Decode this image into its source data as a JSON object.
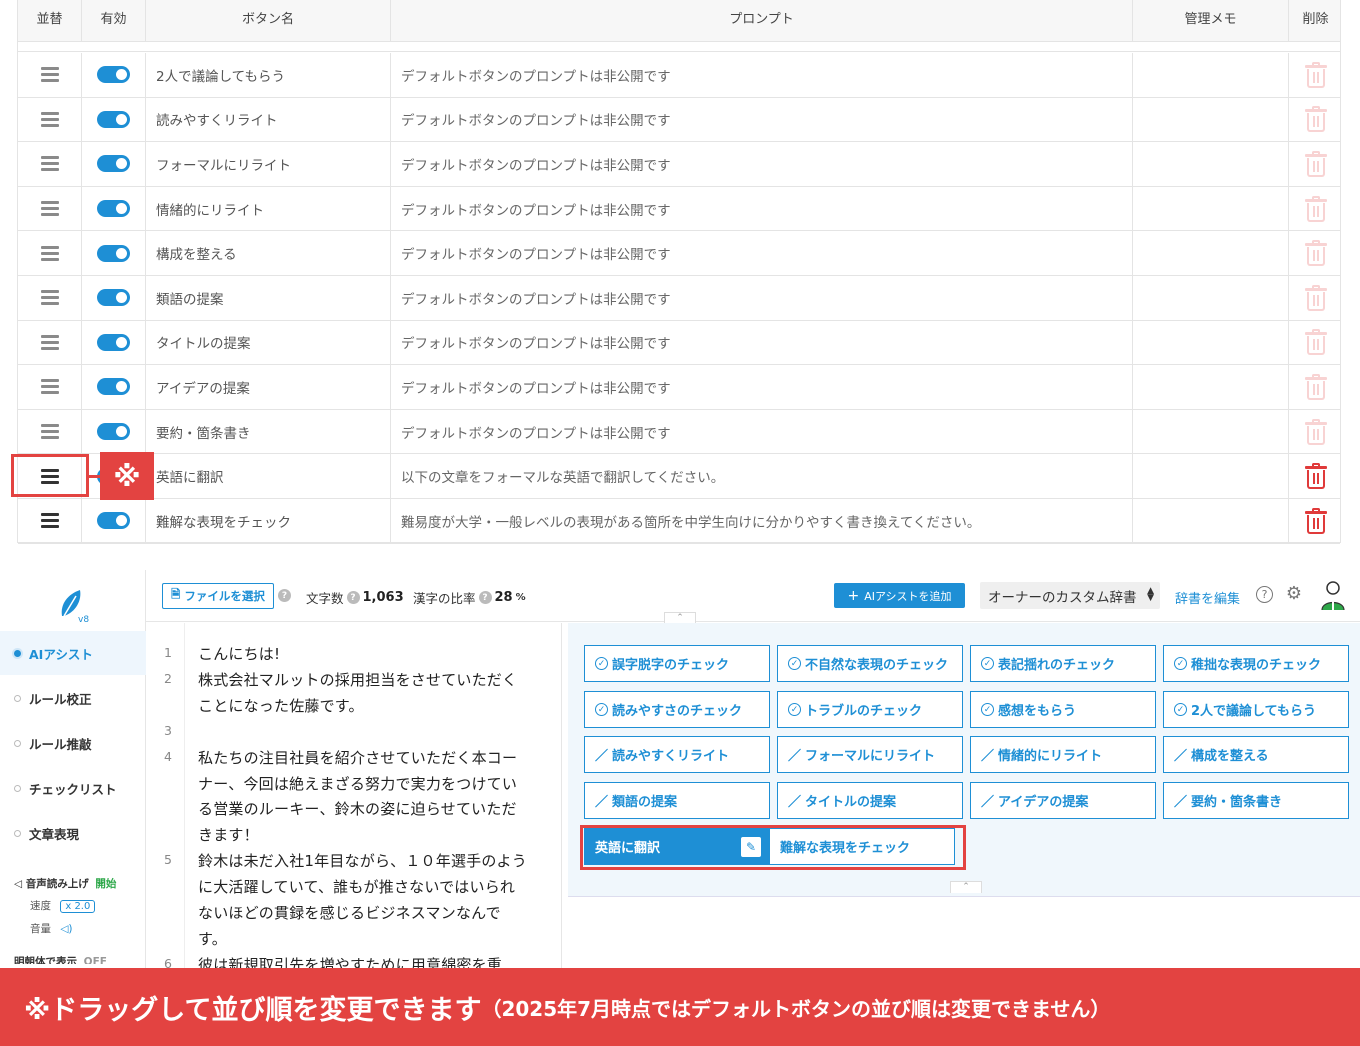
{
  "table": {
    "headers": {
      "sort": "並替",
      "enabled": "有効",
      "name": "ボタン名",
      "prompt": "プロンプト",
      "memo": "管理メモ",
      "delete": "削除"
    },
    "rows": [
      {
        "name": "2人で議論してもらう",
        "prompt": "デフォルトボタンのプロンプトは非公開です",
        "memo": "",
        "custom": false
      },
      {
        "name": "読みやすくリライト",
        "prompt": "デフォルトボタンのプロンプトは非公開です",
        "memo": "",
        "custom": false
      },
      {
        "name": "フォーマルにリライト",
        "prompt": "デフォルトボタンのプロンプトは非公開です",
        "memo": "",
        "custom": false
      },
      {
        "name": "情緒的にリライト",
        "prompt": "デフォルトボタンのプロンプトは非公開です",
        "memo": "",
        "custom": false
      },
      {
        "name": "構成を整える",
        "prompt": "デフォルトボタンのプロンプトは非公開です",
        "memo": "",
        "custom": false
      },
      {
        "name": "類語の提案",
        "prompt": "デフォルトボタンのプロンプトは非公開です",
        "memo": "",
        "custom": false
      },
      {
        "name": "タイトルの提案",
        "prompt": "デフォルトボタンのプロンプトは非公開です",
        "memo": "",
        "custom": false
      },
      {
        "name": "アイデアの提案",
        "prompt": "デフォルトボタンのプロンプトは非公開です",
        "memo": "",
        "custom": false
      },
      {
        "name": "要約・箇条書き",
        "prompt": "デフォルトボタンのプロンプトは非公開です",
        "memo": "",
        "custom": false
      },
      {
        "name": "英語に翻訳",
        "prompt": "以下の文章をフォーマルな英語で翻訳してください。",
        "memo": "",
        "custom": true
      },
      {
        "name": "難解な表現をチェック",
        "prompt": "難易度が大学・一般レベルの表現がある箇所を中学生向けに分かりやすく書き換えてください。",
        "memo": "",
        "custom": true
      }
    ],
    "callout_mark": "※"
  },
  "sidebar": {
    "version": "v8",
    "items": [
      {
        "label": "AIアシスト",
        "active": true
      },
      {
        "label": "ルール校正",
        "active": false
      },
      {
        "label": "ルール推敲",
        "active": false
      },
      {
        "label": "チェックリスト",
        "active": false
      },
      {
        "label": "文章表現",
        "active": false
      }
    ],
    "tts_label": "音声読み上げ",
    "tts_start": "開始",
    "speed_label": "速度",
    "speed_value": "x 2.0",
    "volume_label": "音量",
    "cutoff_label": "明朝体で表示",
    "cutoff_value": "OFF"
  },
  "toolbar": {
    "file_button": "ファイルを選択",
    "char_count_label": "文字数",
    "char_count_value": "1,063",
    "kanji_label": "漢字の比率",
    "kanji_value": "28",
    "kanji_unit": "%",
    "add_button": "AIアシストを追加",
    "dict_select": "オーナーのカスタム辞書",
    "dict_edit": "辞書を編集"
  },
  "editor": {
    "line_numbers": [
      "1",
      "2",
      "",
      "3",
      "4",
      "",
      "",
      "",
      "5",
      "",
      "",
      "",
      "6"
    ],
    "lines": [
      "こんにちは!",
      "株式会社マルットの採用担当をさせていただく",
      "ことになった佐藤です。",
      "",
      "私たちの注目社員を紹介させていただく本コー",
      "ナー、今回は絶えまざる努力で実力をつけてい",
      "る営業のルーキー、鈴木の姿に迫らせていただ",
      "きます！",
      "鈴木は未だ入社1年目ながら、１０年選手のよう",
      "に大活躍していて、誰もが推さないではいられ",
      "ないほどの貫録を感じるビジネスマンなんで",
      "す。",
      "彼は新規取引先を増やすために用意綿密を重"
    ]
  },
  "panel": {
    "check_buttons": [
      "誤字脱字のチェック",
      "不自然な表現のチェック",
      "表記揺れのチェック",
      "稚拙な表現のチェック",
      "読みやすさのチェック",
      "トラブルのチェック",
      "感想をもらう",
      "2人で議論してもらう"
    ],
    "rewrite_buttons": [
      "読みやすくリライト",
      "フォーマルにリライト",
      "情緒的にリライト",
      "構成を整える",
      "類語の提案",
      "タイトルの提案",
      "アイデアの提案",
      "要約・箇条書き"
    ],
    "custom_buttons": [
      "英語に翻訳",
      "難解な表現をチェック"
    ]
  },
  "footer": {
    "main": "※ドラッグして並び順を変更できます",
    "sub": "（2025年7月時点ではデフォルトボタンの並び順は変更できません）"
  },
  "colors": {
    "accent": "#1e8fd5",
    "highlight": "#e34341",
    "trash": "#e03a3a"
  }
}
